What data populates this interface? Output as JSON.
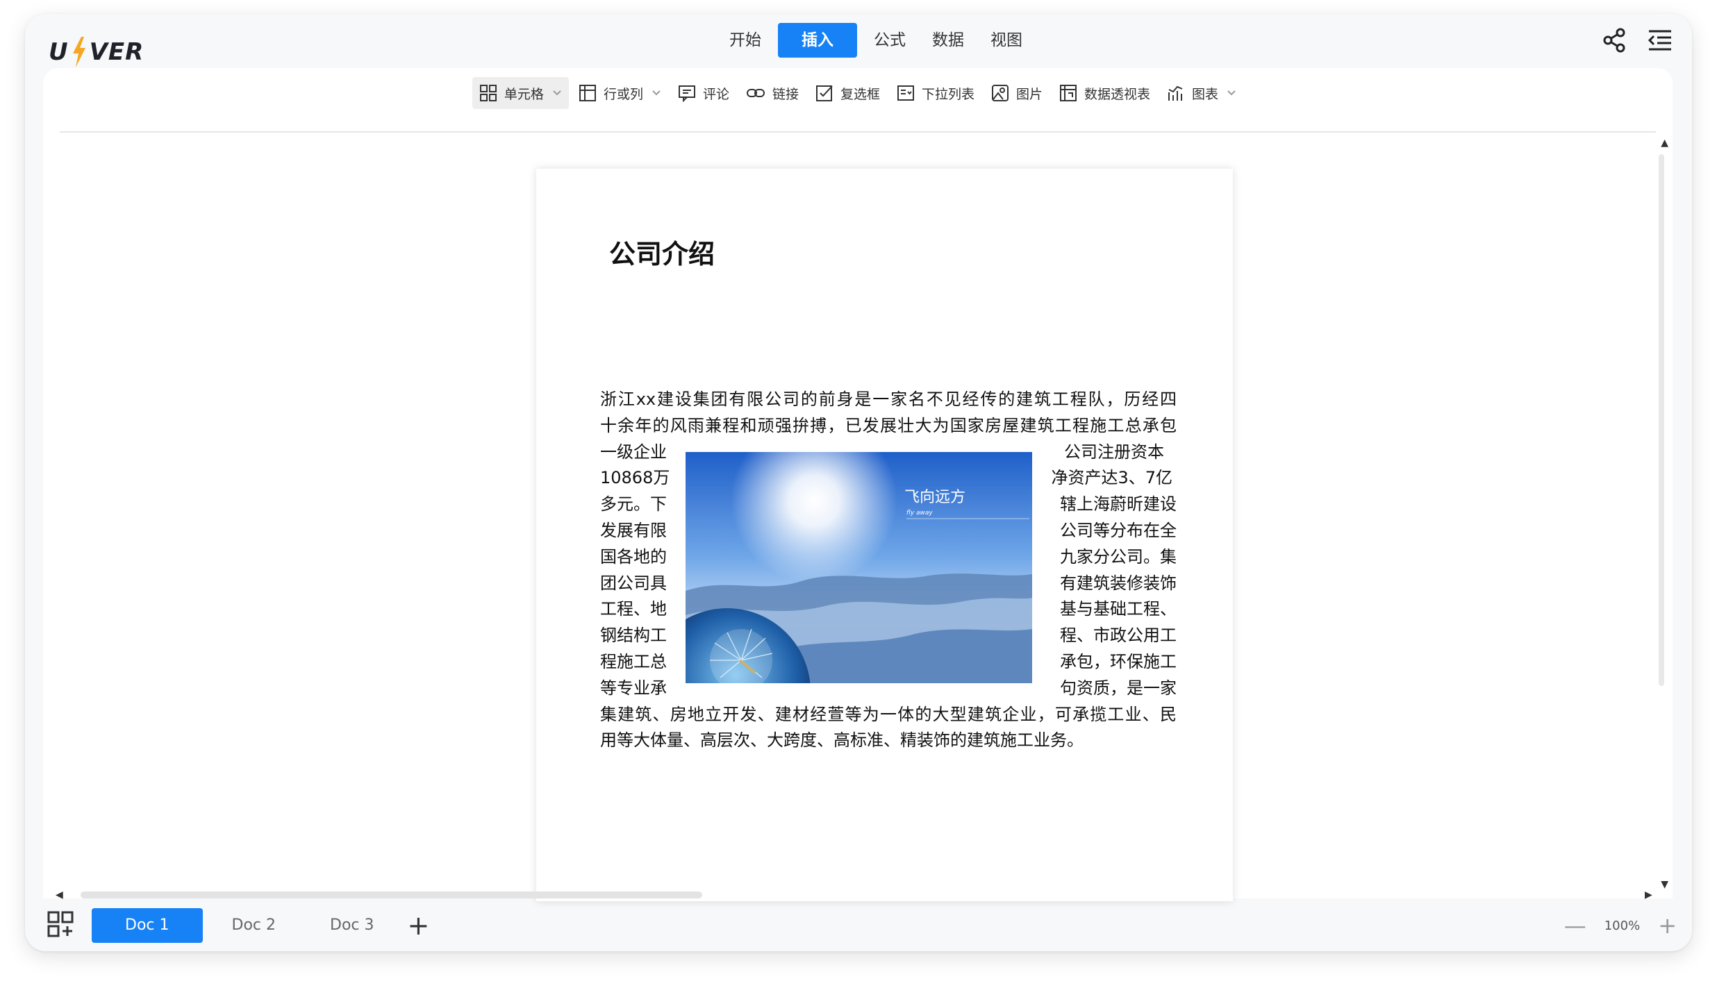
{
  "app": {
    "logo_text_left": "U",
    "logo_text_right": "VER"
  },
  "menu": {
    "tabs": [
      {
        "label": "开始",
        "active": false
      },
      {
        "label": "插入",
        "active": true
      },
      {
        "label": "公式",
        "active": false
      },
      {
        "label": "数据",
        "active": false
      },
      {
        "label": "视图",
        "active": false
      }
    ]
  },
  "top_icons": [
    "share-icon",
    "outline-menu-icon"
  ],
  "toolbar": {
    "items": [
      {
        "label": "单元格",
        "icon": "cell-grid-icon",
        "dropdown": true,
        "selected": true
      },
      {
        "label": "行或列",
        "icon": "row-column-icon",
        "dropdown": true
      },
      {
        "label": "评论",
        "icon": "comment-icon"
      },
      {
        "label": "链接",
        "icon": "link-icon"
      },
      {
        "label": "复选框",
        "icon": "checkbox-icon"
      },
      {
        "label": "下拉列表",
        "icon": "dropdown-list-icon"
      },
      {
        "label": "图片",
        "icon": "image-icon"
      },
      {
        "label": "数据透视表",
        "icon": "pivot-table-icon"
      },
      {
        "label": "图表",
        "icon": "chart-icon",
        "dropdown": true
      }
    ]
  },
  "document": {
    "title": "公司介绍",
    "lines": [
      {
        "full": "浙江xx建设集团有限公司的前身是一家名不见经传的建筑工程队，历经四"
      },
      {
        "full": "十余年的风雨兼程和顽强拚搏，已发展壮大为国家房屋建筑工程施工总承包"
      },
      {
        "left": "一级企业",
        "right": "公司注册资本"
      },
      {
        "left": "10868万",
        "right": "净资产达3、7亿"
      },
      {
        "left": "多元。下",
        "right": "辖上海蔚昕建设"
      },
      {
        "left": "发展有限",
        "right": "公司等分布在全"
      },
      {
        "left": "国各地的",
        "right": "九家分公司。集"
      },
      {
        "left": "团公司具",
        "right": "有建筑装修装饰"
      },
      {
        "left": "工程、地",
        "right": "基与基础工程、"
      },
      {
        "left": "钢结构工",
        "right": "程、市政公用工"
      },
      {
        "left": "程施工总",
        "right": "承包，环保施工"
      },
      {
        "left": "等专业承",
        "right": "句资质，是一家"
      },
      {
        "full": "集建筑、房地立开发、建材经萱等为一体的大型建筑企业，可承揽工业、民"
      },
      {
        "full": "用等大体量、高层次、大跨度、高标准、精装饰的建筑施工业务。"
      }
    ],
    "image": {
      "caption_cn": "飞向远方",
      "caption_en": "fly away"
    }
  },
  "bottom": {
    "doc_tabs": [
      {
        "label": "Doc 1",
        "active": true
      },
      {
        "label": "Doc 2",
        "active": false
      },
      {
        "label": "Doc 3",
        "active": false
      }
    ],
    "add_label": "+",
    "zoom": {
      "minus": "—",
      "value": "100%",
      "plus": "+"
    }
  },
  "colors": {
    "accent": "#1782f6",
    "logo_bolt": "#f5a623"
  }
}
